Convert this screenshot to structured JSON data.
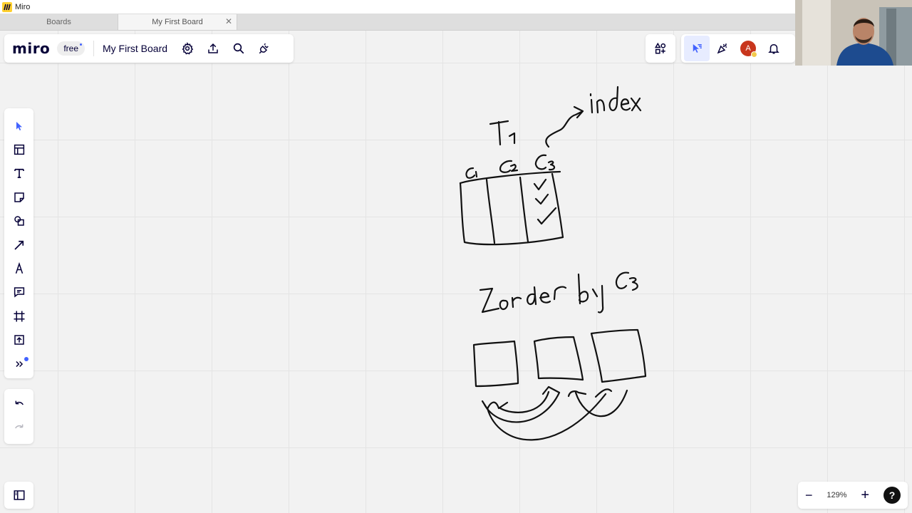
{
  "window": {
    "title": "Miro"
  },
  "tabs": [
    {
      "label": "Boards"
    },
    {
      "label": "My First Board",
      "close": "✕"
    }
  ],
  "header": {
    "logo": "miro",
    "plan_badge": "free",
    "board_name": "My First Board"
  },
  "toolbar": {
    "tools": [
      "select",
      "templates",
      "text",
      "sticky-note",
      "shapes",
      "connection-line",
      "pen",
      "comment",
      "frame",
      "upload",
      "more"
    ]
  },
  "user": {
    "avatar_initial": "A"
  },
  "zoom": {
    "level": "129%",
    "minus": "−",
    "plus": "+",
    "help": "?"
  },
  "board": {
    "handwriting": {
      "table_name": "T₁",
      "columns": [
        "C₁",
        "C₂",
        "C₃"
      ],
      "index_label": "index",
      "zorder_label": "Zorder by C₃"
    }
  },
  "colors": {
    "accent": "#4262ff",
    "avatar": "#c8361d",
    "ink": "#111111"
  }
}
